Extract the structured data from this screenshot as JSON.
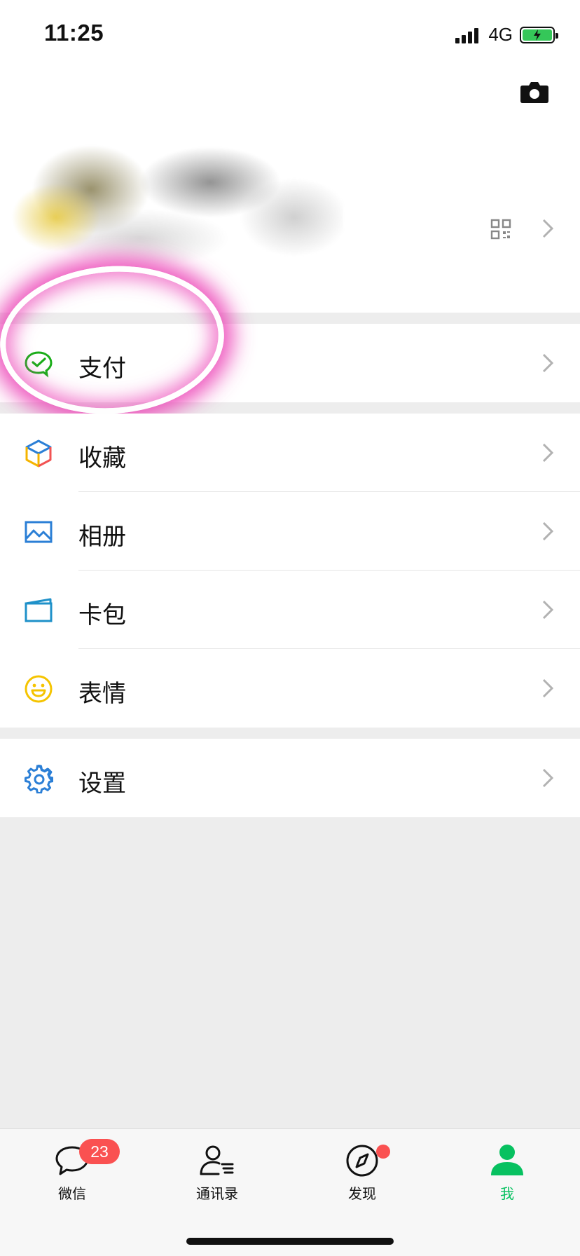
{
  "status_bar": {
    "time": "11:25",
    "network": "4G"
  },
  "profile": {
    "camera_icon": "camera-icon",
    "qr_icon": "qr-code-icon",
    "chevron_icon": "chevron-right-icon"
  },
  "menu": {
    "pay": {
      "label": "支付",
      "icon": "wechat-pay-icon",
      "color": "#1aad19"
    },
    "items": [
      {
        "label": "收藏",
        "icon": "favorites-cube-icon"
      },
      {
        "label": "相册",
        "icon": "album-icon",
        "color": "#2b7fd6"
      },
      {
        "label": "卡包",
        "icon": "card-wallet-icon",
        "color": "#1f91c9"
      },
      {
        "label": "表情",
        "icon": "emoji-icon",
        "color": "#f5c400"
      }
    ],
    "settings": {
      "label": "设置",
      "icon": "gear-icon",
      "color": "#2b7fd6"
    }
  },
  "tab_bar": {
    "tabs": [
      {
        "label": "微信",
        "icon": "chat-bubble-icon",
        "badge": "23"
      },
      {
        "label": "通讯录",
        "icon": "contacts-icon"
      },
      {
        "label": "发现",
        "icon": "compass-icon",
        "dot": true
      },
      {
        "label": "我",
        "icon": "person-icon",
        "active": true
      }
    ],
    "active_color": "#07c160",
    "badge_color": "#fa5151"
  }
}
